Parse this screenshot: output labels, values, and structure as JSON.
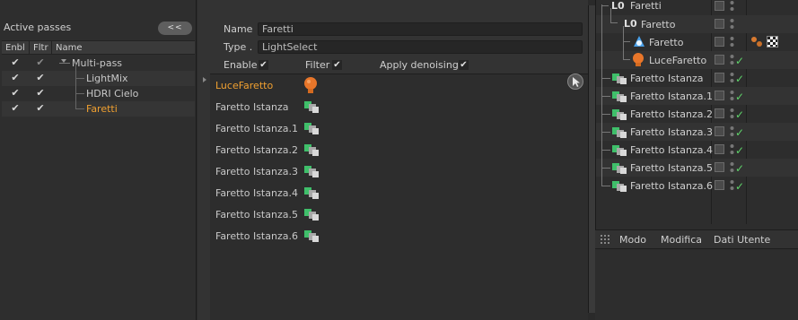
{
  "left_panel": {
    "title": "Active passes",
    "collapse_label": "<<",
    "columns": [
      "Enbl",
      "Fltr",
      "Name"
    ],
    "passes": [
      {
        "name": "Multi-pass",
        "enabled": "✔",
        "filter": "✔",
        "selected": false
      },
      {
        "name": "LightMix",
        "enabled": "✔",
        "filter": "✔",
        "selected": false
      },
      {
        "name": "HDRI Cielo",
        "enabled": "✔",
        "filter": "✔",
        "selected": false
      },
      {
        "name": "Faretti",
        "enabled": "✔",
        "filter": "✔",
        "selected": true
      }
    ]
  },
  "middle_panel": {
    "name_label": "Name",
    "name_value": "Faretti",
    "type_label": "Type .",
    "type_value": "LightSelect",
    "enable_label": "Enable",
    "enable_check": "✔",
    "filter_label": "Filter",
    "filter_check": "✔",
    "denoise_label": "Apply denoising",
    "denoise_check": "✔",
    "lights": [
      {
        "name": "LuceFaretto",
        "icon": "bulb-icon",
        "active": true
      },
      {
        "name": "Faretto Istanza",
        "icon": "instance-icon",
        "active": false
      },
      {
        "name": "Faretto Istanza.1",
        "icon": "instance-icon",
        "active": false
      },
      {
        "name": "Faretto Istanza.2",
        "icon": "instance-icon",
        "active": false
      },
      {
        "name": "Faretto Istanza.3",
        "icon": "instance-icon",
        "active": false
      },
      {
        "name": "Faretto Istanza.4",
        "icon": "instance-icon",
        "active": false
      },
      {
        "name": "Faretto Istanza.5",
        "icon": "instance-icon",
        "active": false
      },
      {
        "name": "Faretto Istanza.6",
        "icon": "instance-icon",
        "active": false
      }
    ]
  },
  "object_manager": {
    "objects": [
      {
        "name": "Faretti",
        "icon": "null-icon",
        "tick": ""
      },
      {
        "name": "Faretto",
        "icon": "null-icon",
        "tick": ""
      },
      {
        "name": "Faretto",
        "icon": "spot-icon",
        "tick": ""
      },
      {
        "name": "LuceFaretto",
        "icon": "bulb-icon",
        "tick": "✓"
      },
      {
        "name": "Faretto Istanza",
        "icon": "instance-icon",
        "tick": "✓"
      },
      {
        "name": "Faretto Istanza.1",
        "icon": "instance-icon",
        "tick": "✓"
      },
      {
        "name": "Faretto Istanza.2",
        "icon": "instance-icon",
        "tick": "✓"
      },
      {
        "name": "Faretto Istanza.3",
        "icon": "instance-icon",
        "tick": "✓"
      },
      {
        "name": "Faretto Istanza.4",
        "icon": "instance-icon",
        "tick": "✓"
      },
      {
        "name": "Faretto Istanza.5",
        "icon": "instance-icon",
        "tick": "✓"
      },
      {
        "name": "Faretto Istanza.6",
        "icon": "instance-icon",
        "tick": "✓"
      }
    ]
  },
  "attribute_manager": {
    "menu": [
      "Modo",
      "Modifica",
      "Dati Utente"
    ]
  },
  "colors": {
    "selected": "#f0a030",
    "tick": "#5fd46a",
    "cube": "#3fbf6a"
  }
}
